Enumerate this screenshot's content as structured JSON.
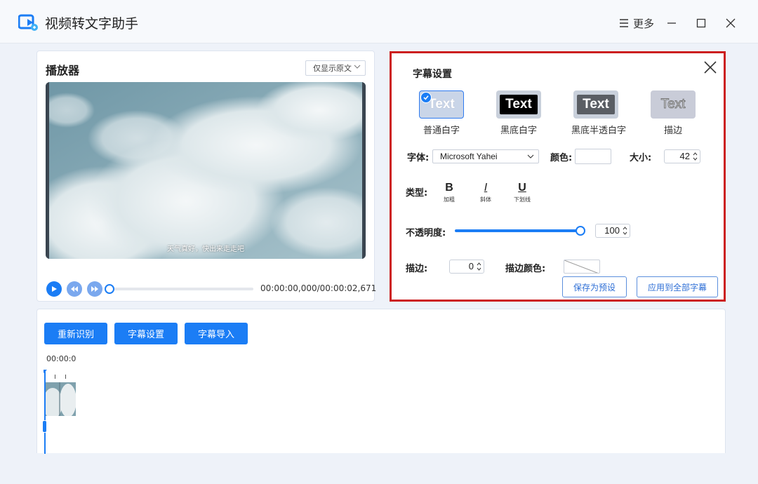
{
  "app": {
    "title": "视频转文字助手",
    "more_label": "更多"
  },
  "player": {
    "title": "播放器",
    "display_mode": "仅显示原文",
    "subtitle_text": "天气真好，快出来走走吧",
    "time_text": "00:00:00,000/00:00:02,671",
    "progress": 0
  },
  "subtitle_settings": {
    "title": "字幕设置",
    "presets": [
      {
        "label": "普通白字",
        "sample": "Text",
        "selected": true
      },
      {
        "label": "黑底白字",
        "sample": "Text",
        "selected": false
      },
      {
        "label": "黑底半透白字",
        "sample": "Text",
        "selected": false
      },
      {
        "label": "描边",
        "sample": "Text",
        "selected": false
      }
    ],
    "font_label": "字体:",
    "font_value": "Microsoft Yahei",
    "color_label": "颜色:",
    "size_label": "大小:",
    "size_value": "42",
    "type_label": "类型:",
    "styles": [
      {
        "glyph": "B",
        "label": "加粗"
      },
      {
        "glyph": "I",
        "label": "斜体"
      },
      {
        "glyph": "U",
        "label": "下划线"
      }
    ],
    "opacity_label": "不透明度:",
    "opacity_value": "100",
    "stroke_label": "描边:",
    "stroke_value": "0",
    "stroke_color_label": "描边颜色:",
    "save_preset_label": "保存为预设",
    "apply_all_label": "应用到全部字幕"
  },
  "toolbar": {
    "re_recognize": "重新识别",
    "subtitle_settings": "字幕设置",
    "subtitle_import": "字幕导入"
  },
  "timeline": {
    "time_label": "00:00:00"
  },
  "colors": {
    "accent": "#1b7df5",
    "highlight_border": "#cc1f1f"
  }
}
